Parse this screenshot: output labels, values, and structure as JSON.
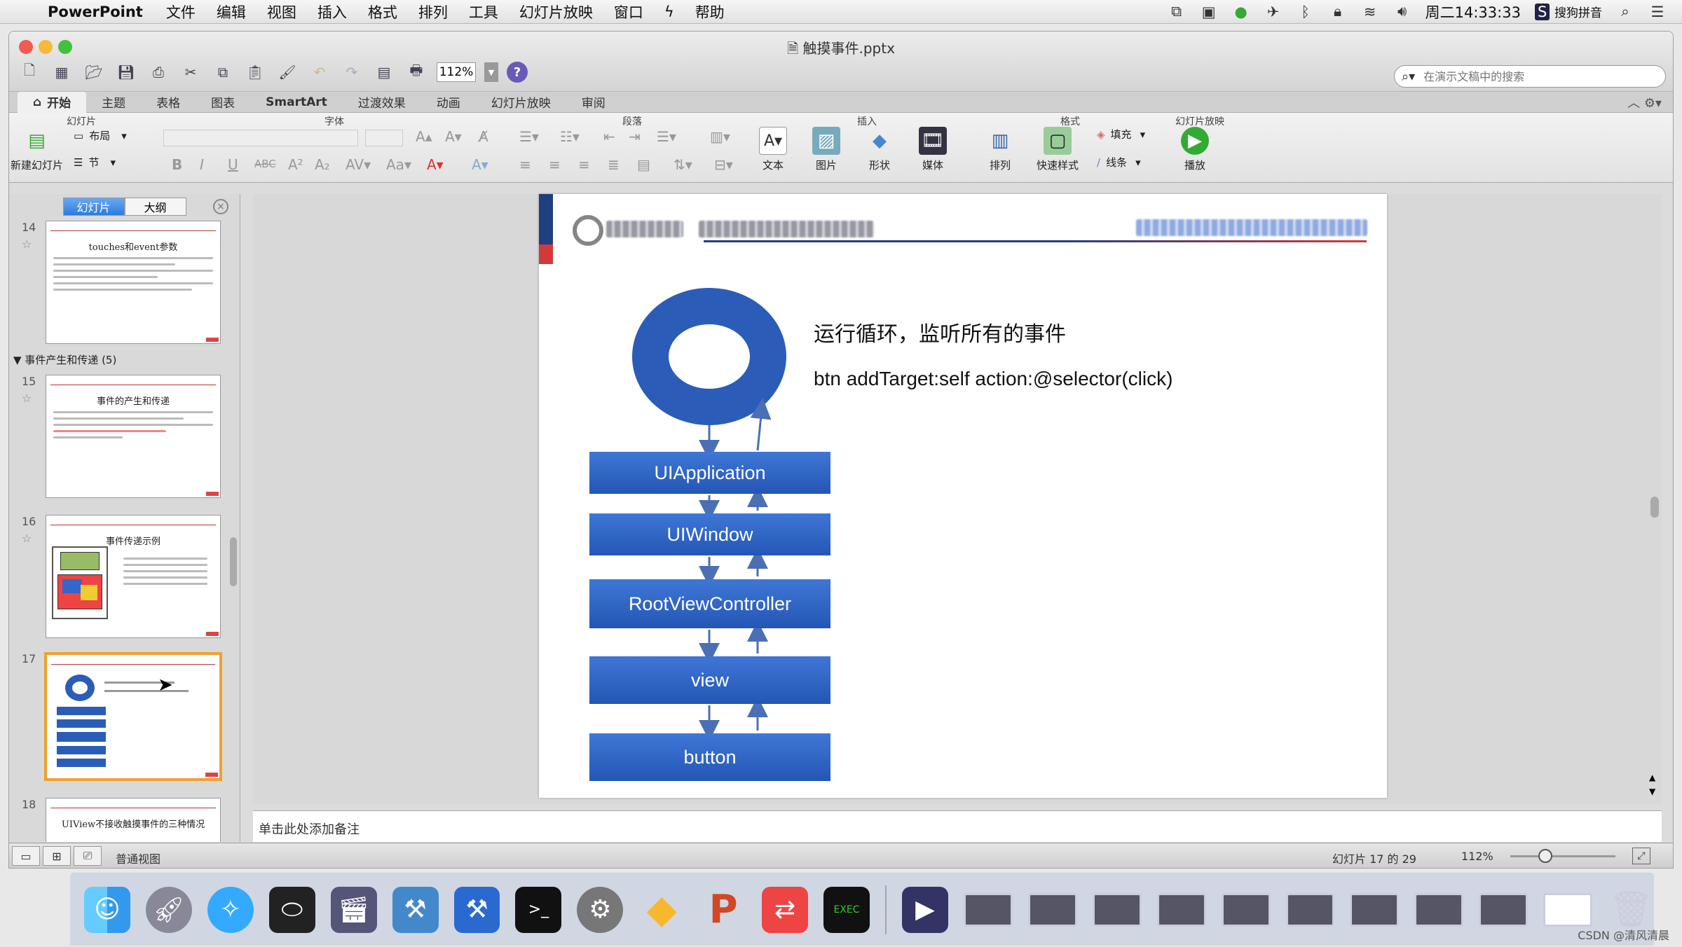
{
  "menubar": {
    "app": "PowerPoint",
    "menus": [
      "文件",
      "编辑",
      "视图",
      "插入",
      "格式",
      "排列",
      "工具",
      "幻灯片放映",
      "窗口",
      "帮助"
    ],
    "clock": "周二14:33:33",
    "input_method": "搜狗拼音"
  },
  "window": {
    "title": "触摸事件.pptx",
    "zoom": "112%",
    "search_placeholder": "在演示文稿中的搜索"
  },
  "ribbon_tabs": [
    "开始",
    "主题",
    "表格",
    "图表",
    "SmartArt",
    "过渡效果",
    "动画",
    "幻灯片放映",
    "审阅"
  ],
  "ribbon": {
    "groups": {
      "slides": "幻灯片",
      "font": "字体",
      "paragraph": "段落",
      "insert": "插入",
      "format": "格式",
      "slideshow": "幻灯片放映"
    },
    "new_slide": "新建幻灯片",
    "layout": "布局",
    "section": "节",
    "insert_items": [
      "文本",
      "图片",
      "形状",
      "媒体"
    ],
    "arrange": "排列",
    "quick_styles": "快速样式",
    "fill": "填充",
    "line": "线条",
    "play": "播放"
  },
  "sidebar": {
    "tab_slides": "幻灯片",
    "tab_outline": "大纲",
    "section_header": "▼ 事件产生和传递 (5)",
    "thumbs": [
      {
        "num": "14",
        "title": "touches和event参数"
      },
      {
        "num": "15",
        "title": "事件的产生和传递"
      },
      {
        "num": "16",
        "title": "事件传递示例"
      },
      {
        "num": "17",
        "title": ""
      },
      {
        "num": "18",
        "title": "UIView不接收触摸事件的三种情况"
      }
    ]
  },
  "slide": {
    "caption_cn": "运行循环，监听所有的事件",
    "caption_code": "btn addTarget:self action:@selector(click)",
    "stack": [
      "UIApplication",
      "UIWindow",
      "RootViewController",
      "view",
      "button"
    ],
    "colors": {
      "primary": "#2b5db8",
      "accent_red": "#d23a3a",
      "header_blue": "#1f3f80"
    }
  },
  "notes_placeholder": "单击此处添加备注",
  "statusbar": {
    "mode": "普通视图",
    "page": "幻灯片 17 的 29",
    "zoom": "112%"
  },
  "watermark": "CSDN @清风清晨"
}
